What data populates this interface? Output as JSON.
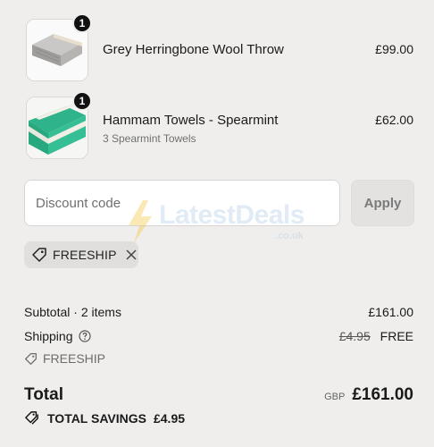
{
  "items": [
    {
      "name": "Grey Herringbone Wool Throw",
      "variant": "",
      "price": "£99.00",
      "qty": "1",
      "image": "grey-throw-image"
    },
    {
      "name": "Hammam Towels - Spearmint",
      "variant": "3 Spearmint Towels",
      "price": "£62.00",
      "qty": "1",
      "image": "spearmint-towels-image"
    }
  ],
  "discount": {
    "placeholder": "Discount code",
    "apply_label": "Apply"
  },
  "applied_code": {
    "code": "FREESHIP"
  },
  "summary": {
    "subtotal_label": "Subtotal · 2 items",
    "subtotal_value": "£161.00",
    "shipping_label": "Shipping",
    "shipping_original": "£4.95",
    "shipping_value": "FREE",
    "shipping_code": "FREESHIP",
    "total_label": "Total",
    "currency": "GBP",
    "total_value": "£161.00",
    "savings_label": "TOTAL SAVINGS",
    "savings_value": "£4.95"
  },
  "watermark": {
    "text": "LatestDeals",
    "sub": ".co.uk"
  }
}
